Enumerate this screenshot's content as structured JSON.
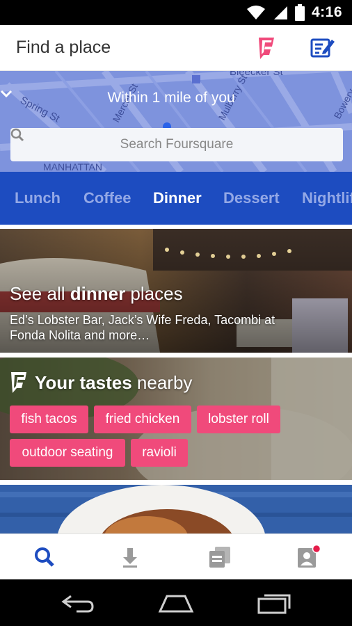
{
  "status": {
    "time": "4:16"
  },
  "header": {
    "title": "Find a place",
    "logo_icon": "foursquare-logo-icon",
    "compose_icon": "compose-icon"
  },
  "map": {
    "filter_label": "Within 1 mile of you",
    "search_placeholder": "Search Foursquare",
    "labels": {
      "bleecker": "Bleecker St",
      "spring": "Spring St",
      "mercer": "Mercer St",
      "mulberry": "Mulberry St",
      "manhattan": "MANHATTAN",
      "bowery": "Bowery"
    }
  },
  "categories": [
    "Lunch",
    "Coffee",
    "Dinner",
    "Dessert",
    "Nightlife"
  ],
  "active_category": "Dinner",
  "card_dinner": {
    "title_pre": "See all ",
    "title_bold": "dinner",
    "title_post": " places",
    "subtitle": "Ed’s Lobster Bar, Jack’s Wife Freda, Tacombi at Fonda Nolita and more…"
  },
  "card_tastes": {
    "title_bold": "Your tastes",
    "title_post": " nearby",
    "chips": [
      "fish tacos",
      "fried chicken",
      "lobster roll",
      "outdoor seating",
      "ravioli"
    ]
  },
  "bottom_nav": [
    "search-icon",
    "download-icon",
    "lists-icon",
    "profile-icon"
  ],
  "colors": {
    "brand_pink": "#f04a7b",
    "brand_blue": "#1d4cc0",
    "map_blue": "#7e93dd"
  }
}
